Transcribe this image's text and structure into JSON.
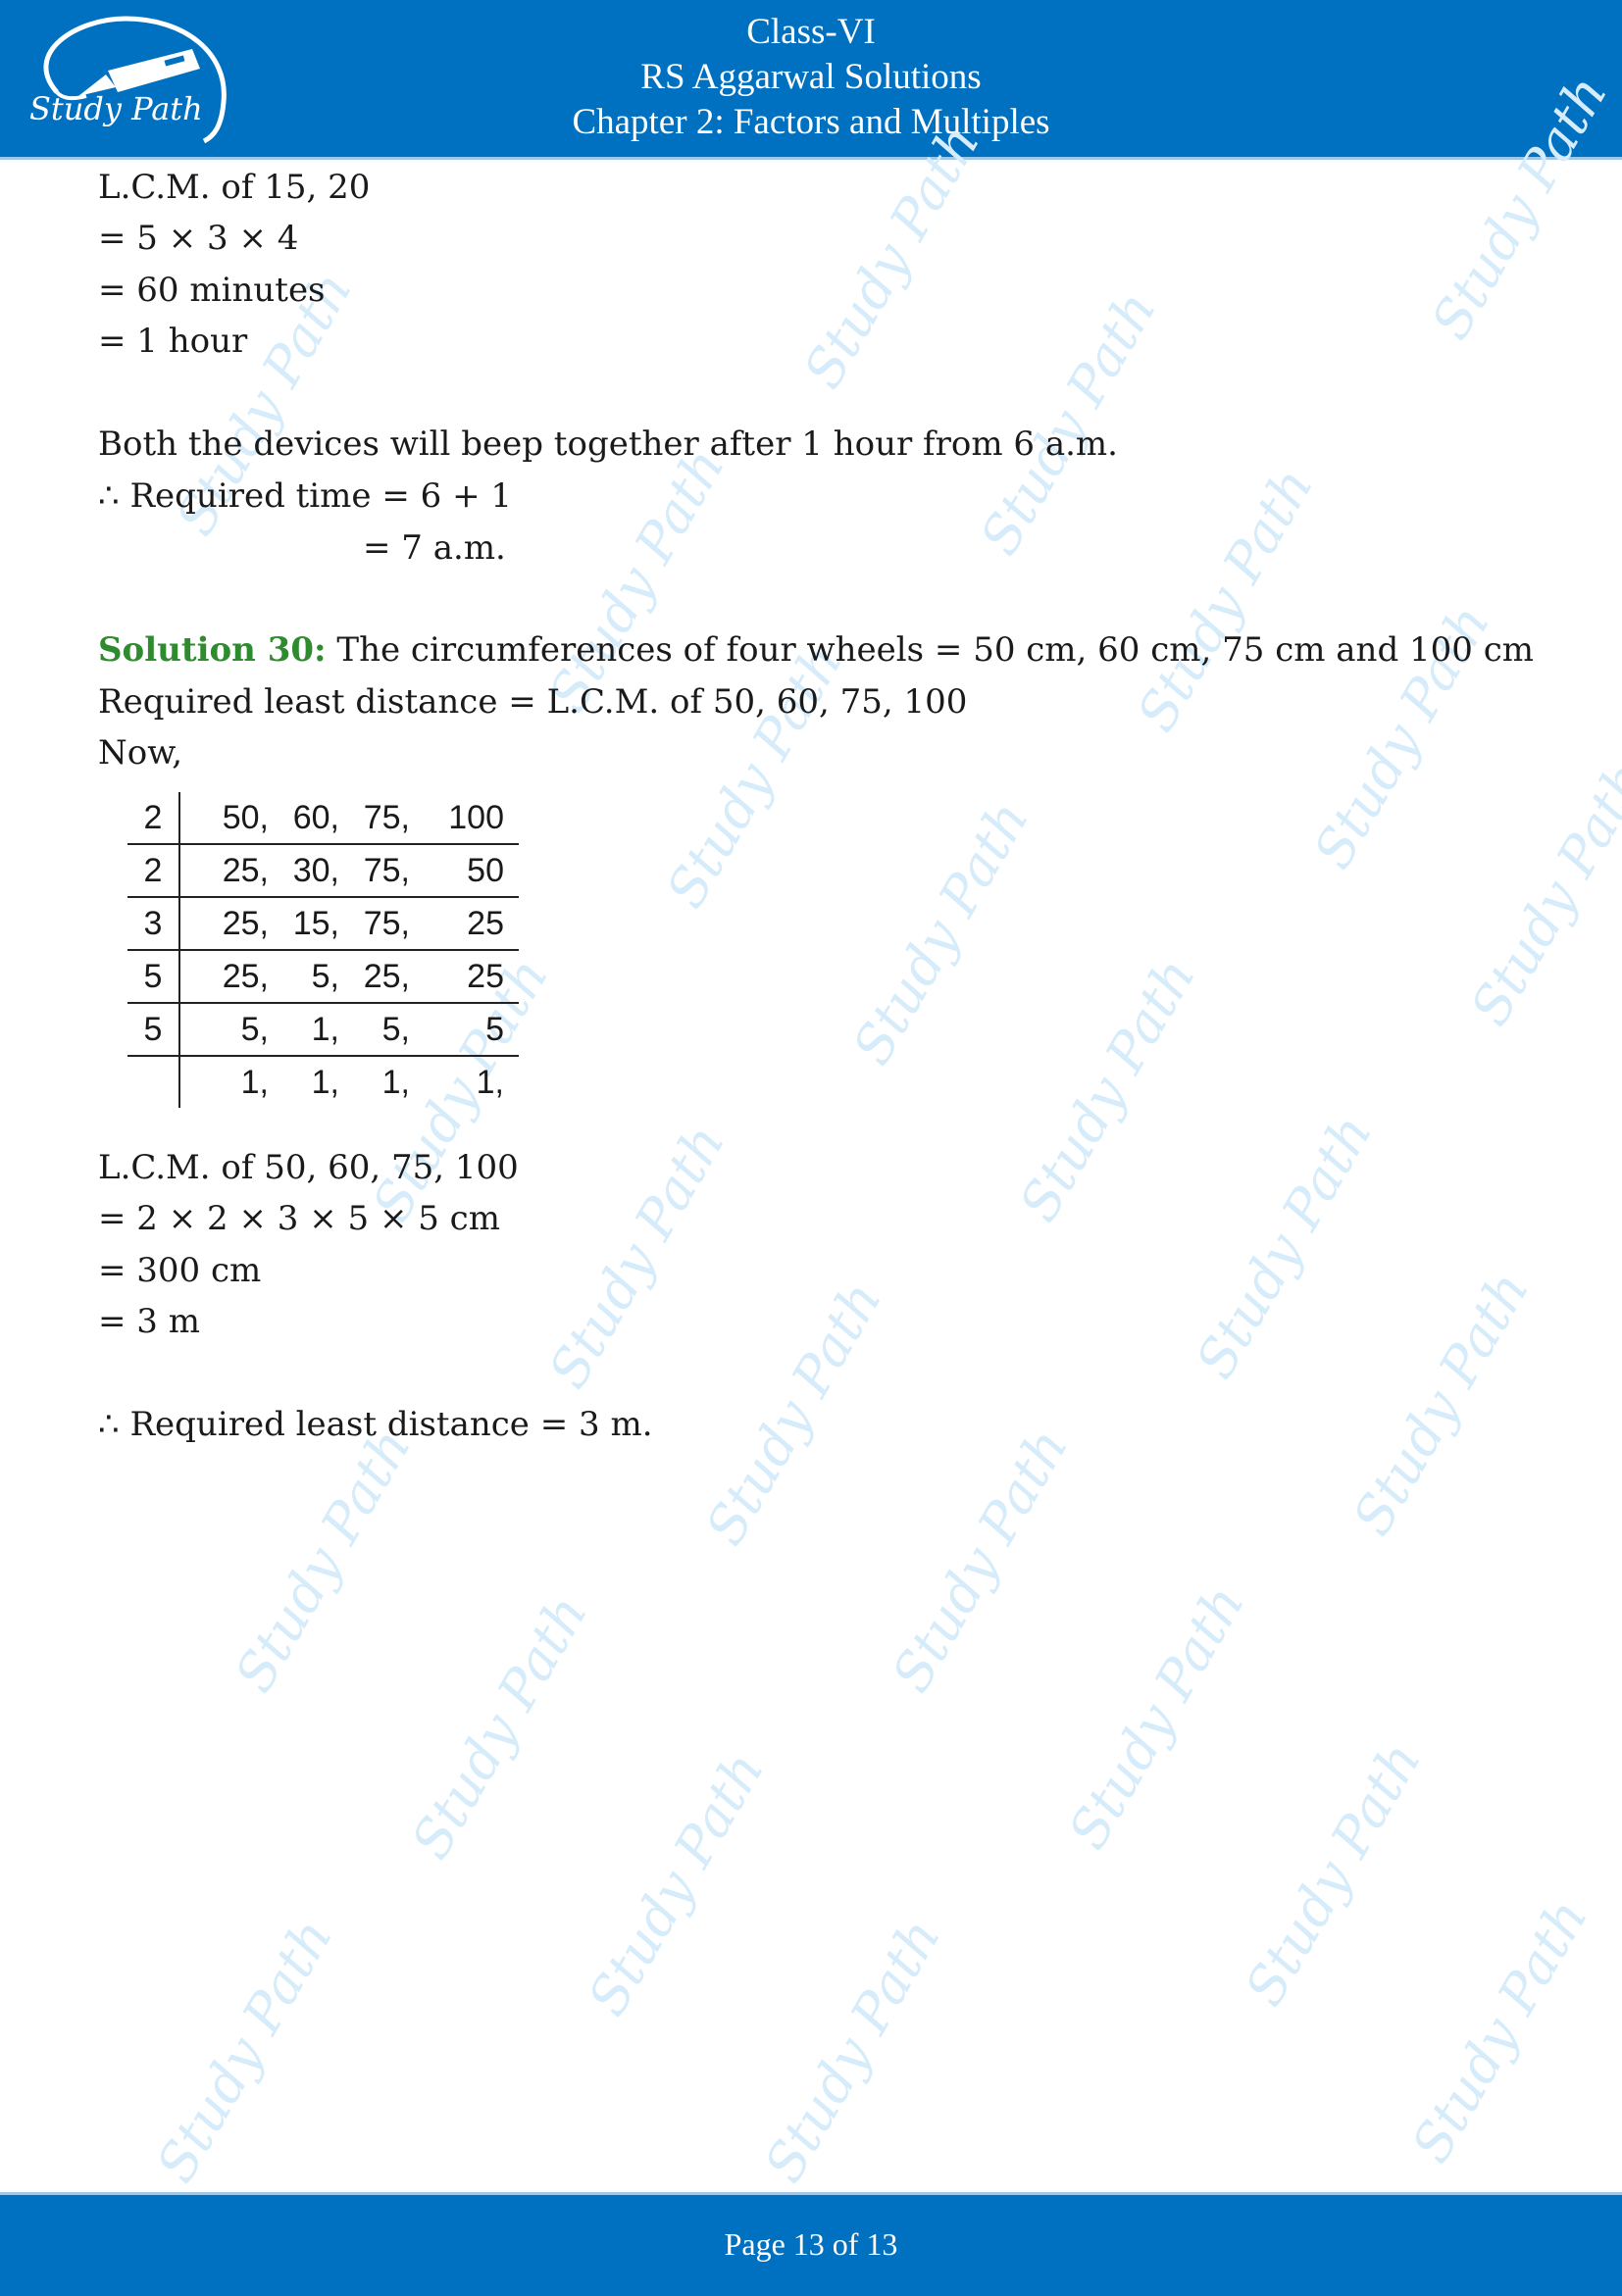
{
  "header": {
    "logo_text": "Study Path",
    "line1": "Class-VI",
    "line2": "RS Aggarwal Solutions",
    "line3": "Chapter 2: Factors and Multiples"
  },
  "previous_solution": {
    "lines": [
      "L.C.M. of 15, 20",
      "= 5 × 3 × 4",
      "= 60 minutes",
      "= 1 hour",
      "Both the devices will beep together after 1 hour from 6 a.m.",
      "∴ Required time = 6 + 1",
      "= 7 a.m."
    ]
  },
  "solution30": {
    "label": "Solution 30:",
    "statement": " The circumferences of four wheels = 50 cm, 60 cm, 75 cm and 100 cm",
    "line2": "Required least distance = L.C.M. of 50, 60, 75, 100",
    "line3": "Now,",
    "division_table": [
      {
        "divisor": "2",
        "values": [
          "50,",
          "60,",
          "75,",
          "100"
        ]
      },
      {
        "divisor": "2",
        "values": [
          "25,",
          "30,",
          "75,",
          "50"
        ]
      },
      {
        "divisor": "3",
        "values": [
          "25,",
          "15,",
          "75,",
          "25"
        ]
      },
      {
        "divisor": "5",
        "values": [
          "25,",
          "5,",
          "25,",
          "25"
        ]
      },
      {
        "divisor": "5",
        "values": [
          "5,",
          "1,",
          "5,",
          "5"
        ]
      },
      {
        "divisor": "",
        "values": [
          "1,",
          "1,",
          "1,",
          "1,"
        ]
      }
    ],
    "result_lines": [
      "L.C.M. of 50, 60, 75, 100",
      "= 2 × 2 × 3 × 5 × 5 cm",
      "= 300 cm",
      "= 3 m"
    ],
    "conclusion": "∴ Required least distance = 3 m."
  },
  "watermark_text": "Study Path",
  "footer": {
    "page_text": "Page 13 of 13"
  },
  "colors": {
    "brand_blue": "#0070c0",
    "solution_green": "#2e8b2e"
  }
}
